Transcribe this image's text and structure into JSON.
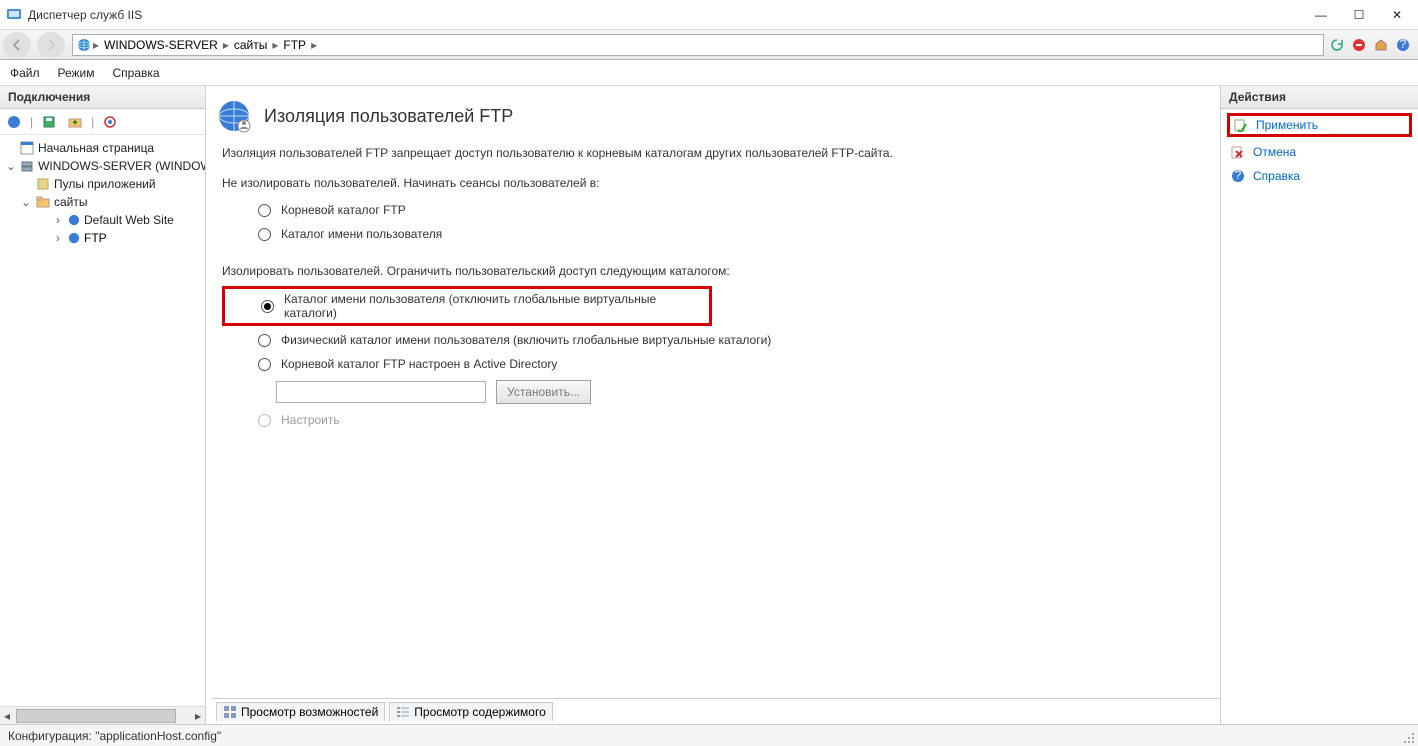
{
  "window": {
    "title": "Диспетчер служб IIS"
  },
  "breadcrumb": {
    "items": [
      "WINDOWS-SERVER",
      "сайты",
      "FTP"
    ]
  },
  "menu": {
    "file": "Файл",
    "mode": "Режим",
    "help": "Справка"
  },
  "left": {
    "header": "Подключения",
    "tree": {
      "start": "Начальная страница",
      "server": "WINDOWS-SERVER (WINDOWS",
      "pools": "Пулы приложений",
      "sites": "сайты",
      "default": "Default Web Site",
      "ftp": "FTP"
    }
  },
  "page": {
    "title": "Изоляция пользователей FTP",
    "description": "Изоляция пользователей FTP запрещает доступ пользователю к корневым каталогам других пользователей FTP-сайта.",
    "group1_label": "Не изолировать пользователей. Начинать сеансы пользователей в:",
    "opt_root": "Корневой каталог FTP",
    "opt_username": "Каталог имени пользователя",
    "group2_label": "Изолировать пользователей. Ограничить пользовательский доступ следующим каталогом:",
    "opt_isolate_user": "Каталог имени пользователя (отключить глобальные виртуальные каталоги)",
    "opt_physical": "Физический каталог имени пользователя (включить глобальные виртуальные каталоги)",
    "opt_ad": "Корневой каталог FTP настроен в Active Directory",
    "btn_set": "Установить...",
    "opt_custom": "Настроить"
  },
  "tabs": {
    "features": "Просмотр возможностей",
    "content": "Просмотр содержимого"
  },
  "actions": {
    "header": "Действия",
    "apply": "Применить",
    "cancel": "Отмена",
    "help": "Справка"
  },
  "status": {
    "text": "Конфигурация: \"applicationHost.config\""
  }
}
